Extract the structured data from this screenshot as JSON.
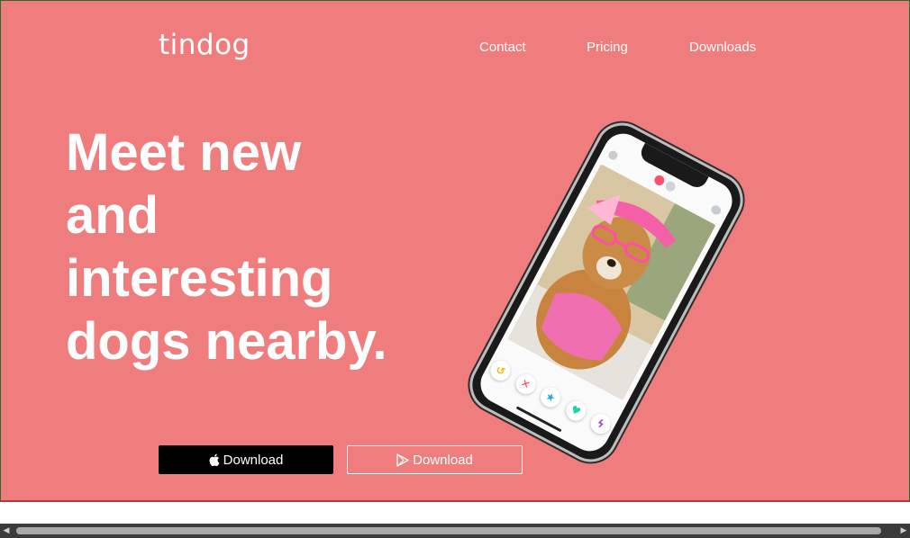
{
  "brand": {
    "name": "tindog"
  },
  "nav": {
    "items": [
      {
        "label": "Contact"
      },
      {
        "label": "Pricing"
      },
      {
        "label": "Downloads"
      }
    ]
  },
  "hero": {
    "headline": "Meet new and interesting dogs nearby.",
    "buttons": {
      "app_store_label": "Download",
      "play_store_label": "Download"
    }
  },
  "colors": {
    "background": "#ef7d7d",
    "text": "#ffffff",
    "button_dark": "#000000"
  },
  "icons": {
    "app_store": "apple-icon",
    "play_store": "play-store-icon"
  }
}
